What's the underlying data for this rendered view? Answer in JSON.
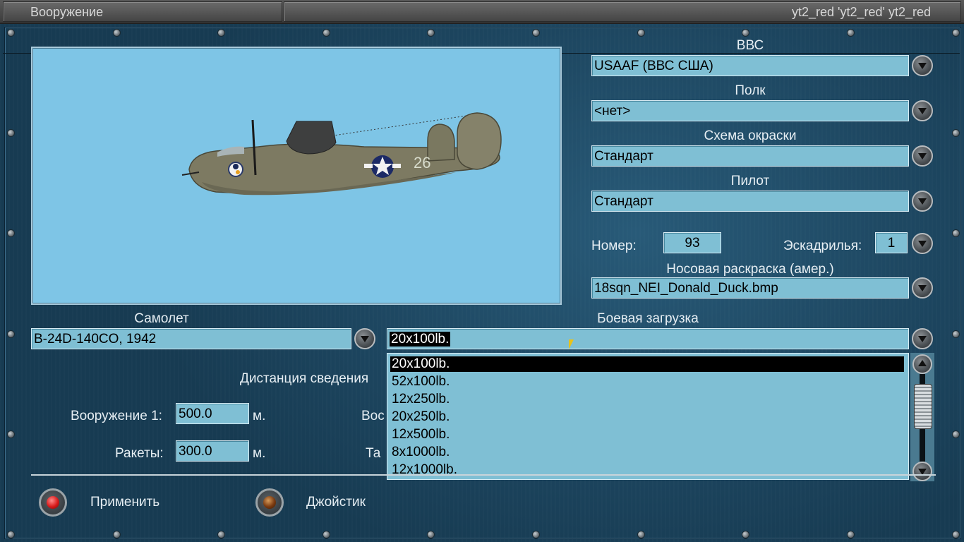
{
  "window": {
    "title": "Вооружение",
    "user_label": "yt2_red 'yt2_red' yt2_red"
  },
  "right_panel": {
    "vvs_label": "ВВС",
    "vvs_value": "USAAF (ВВС США)",
    "regiment_label": "Полк",
    "regiment_value": "<нет>",
    "paint_label": "Схема окраски",
    "paint_value": "Стандарт",
    "pilot_label": "Пилот",
    "pilot_value": "Стандарт",
    "number_label": "Номер:",
    "number_value": "93",
    "squadron_label": "Эскадрилья:",
    "squadron_value": "1",
    "nose_art_label": "Носовая раскраска (амер.)",
    "nose_art_value": "18sqn_NEI_Donald_Duck.bmp"
  },
  "aircraft": {
    "label": "Самолет",
    "value": "B-24D-140CO, 1942",
    "tail_number": "26"
  },
  "loadout": {
    "label": "Боевая загрузка",
    "value": "20x100lb.",
    "options": [
      "20x100lb.",
      "52x100lb.",
      "12x250lb.",
      "20x250lb.",
      "12x500lb.",
      "8x1000lb.",
      "12x1000lb."
    ],
    "selected_index": 0
  },
  "convergence": {
    "label": "Дистанция сведения",
    "weapon1_label": "Вооружение 1:",
    "weapon1_value": "500.0",
    "weapon1_unit": "м.",
    "rockets_label": "Ракеты:",
    "rockets_value": "300.0",
    "rockets_unit": "м.",
    "weapon2_label_partial": "Вос",
    "delay_label_partial": "Та"
  },
  "bottom": {
    "apply_label": "Применить",
    "joystick_label": "Джойстик"
  },
  "colors": {
    "field_bg": "#7fbfd4",
    "preview_bg": "#7ec5e6",
    "panel_bg": "#1f4a66",
    "apply_lamp": "#d81a1a",
    "joystick_lamp": "#7a3a10"
  }
}
